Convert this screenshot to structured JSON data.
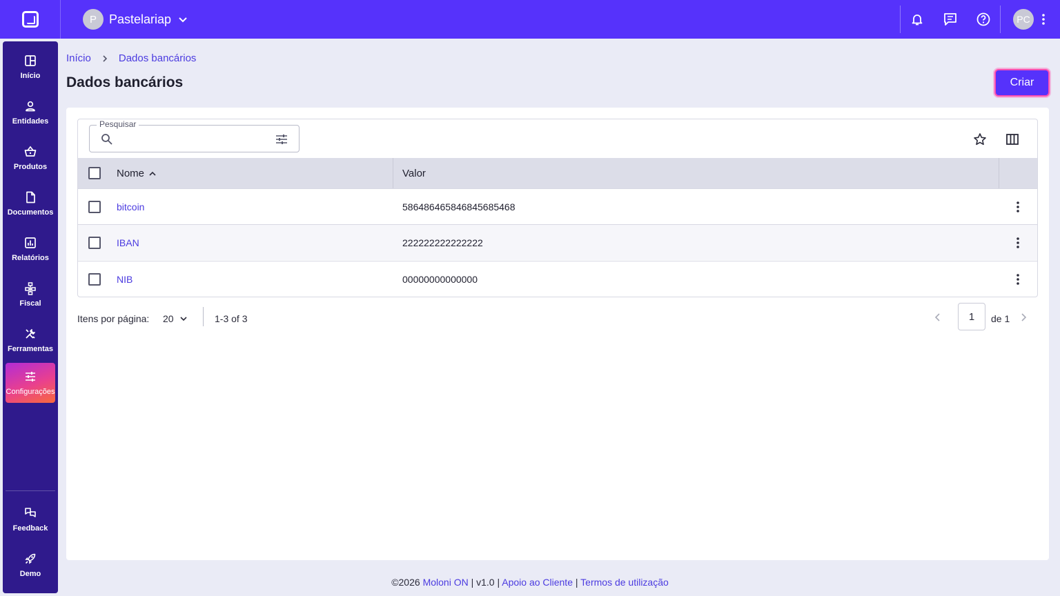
{
  "app": {
    "company_initial": "P",
    "company_name": "Pastelariap",
    "user_initials": "PC",
    "accent_color": "#5632fb",
    "sidebar_color": "#2f1a8c"
  },
  "sidebar": {
    "items": [
      {
        "label": "Início",
        "icon": "dashboard-icon"
      },
      {
        "label": "Entidades",
        "icon": "person-icon"
      },
      {
        "label": "Produtos",
        "icon": "basket-icon"
      },
      {
        "label": "Documentos",
        "icon": "document-icon"
      },
      {
        "label": "Relatórios",
        "icon": "chart-icon"
      },
      {
        "label": "Fiscal",
        "icon": "hierarchy-icon"
      },
      {
        "label": "Ferramentas",
        "icon": "tools-icon"
      },
      {
        "label": "Configurações",
        "icon": "sliders-icon",
        "active": true
      },
      {
        "label": "Feedback",
        "icon": "feedback-icon"
      },
      {
        "label": "Demo",
        "icon": "rocket-icon"
      }
    ]
  },
  "breadcrumb": {
    "home": "Início",
    "current": "Dados bancários"
  },
  "page": {
    "title": "Dados bancários",
    "create_label": "Criar"
  },
  "search": {
    "legend": "Pesquisar",
    "value": ""
  },
  "table": {
    "columns": [
      "Nome",
      "Valor"
    ],
    "rows": [
      {
        "name": "bitcoin",
        "value": "586486465846845685468"
      },
      {
        "name": "IBAN",
        "value": "222222222222222"
      },
      {
        "name": "NIB",
        "value": "00000000000000"
      }
    ]
  },
  "pagination": {
    "items_per_page_label": "Itens por página:",
    "items_per_page": "20",
    "range": "1-3 of 3",
    "page": "1",
    "of_label": "de 1"
  },
  "footer": {
    "copyright": "©2026",
    "brand": "Moloni ON",
    "version": "v1.0",
    "support": "Apoio ao Cliente",
    "terms": "Termos de utilização",
    "sep": "|"
  }
}
